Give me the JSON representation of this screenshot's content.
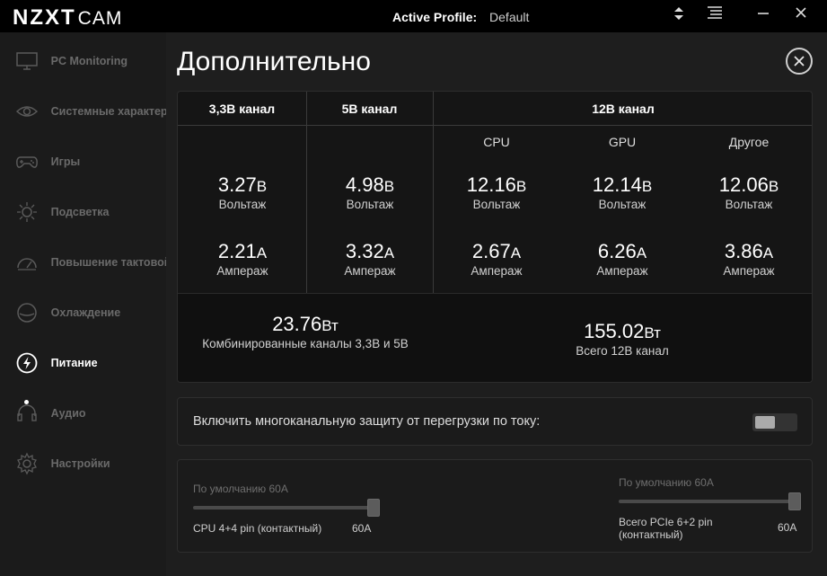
{
  "app": {
    "logo_bold": "NZXT",
    "logo_thin": "CAM",
    "active_profile_label": "Active Profile:",
    "active_profile_value": "Default",
    "titlebar_icons": [
      "updown-icon",
      "menu-icon",
      "minimize-icon",
      "close-icon"
    ]
  },
  "sidebar": {
    "items": [
      {
        "label": "PC Monitoring",
        "icon": "monitor-icon",
        "active": false
      },
      {
        "label": "Системные характеристики",
        "icon": "eye-icon",
        "active": false
      },
      {
        "label": "Игры",
        "icon": "gamepad-icon",
        "active": false
      },
      {
        "label": "Подсветка",
        "icon": "sun-icon",
        "active": false
      },
      {
        "label": "Повышение тактовой",
        "icon": "gauge-icon",
        "active": false
      },
      {
        "label": "Охлаждение",
        "icon": "fan-icon",
        "active": false
      },
      {
        "label": "Питание",
        "icon": "power-icon",
        "active": true
      },
      {
        "label": "Аудио",
        "icon": "headset-icon",
        "active": false
      },
      {
        "label": "Настройки",
        "icon": "gear-icon",
        "active": false
      }
    ]
  },
  "page": {
    "title": "Дополнительно"
  },
  "channels": {
    "head_33": "3,3В канал",
    "head_5": "5В канал",
    "head_12": "12В канал",
    "sub_cpu": "CPU",
    "sub_gpu": "GPU",
    "sub_other": "Другое",
    "volt_caption": "Вольтаж",
    "amp_caption": "Ампераж",
    "volt_unit": "В",
    "amp_unit": "А",
    "readings": [
      {
        "volt": "3.27",
        "amp": "2.21"
      },
      {
        "volt": "4.98",
        "amp": "3.32"
      },
      {
        "volt": "12.16",
        "amp": "2.67"
      },
      {
        "volt": "12.14",
        "amp": "6.26"
      },
      {
        "volt": "12.06",
        "amp": "3.86"
      }
    ],
    "combined_value": "23.76",
    "combined_unit": "Вт",
    "combined_caption": "Комбинированные каналы 3,3В и 5В",
    "total12_value": "155.02",
    "total12_unit": "Вт",
    "total12_caption": "Всего 12В канал"
  },
  "protection": {
    "label": "Включить многоканальную защиту от перегрузки по току:",
    "enabled": false
  },
  "sliders": [
    {
      "default_text": "По умолчанию 60А",
      "label": "CPU 4+4 pin (контактный)",
      "value": "60А",
      "level": 1.0
    },
    {
      "default_text": "По умолчанию 60А",
      "label": "Всего PCIe 6+2 pin (контактный)",
      "value": "60А",
      "level": 1.0
    }
  ]
}
